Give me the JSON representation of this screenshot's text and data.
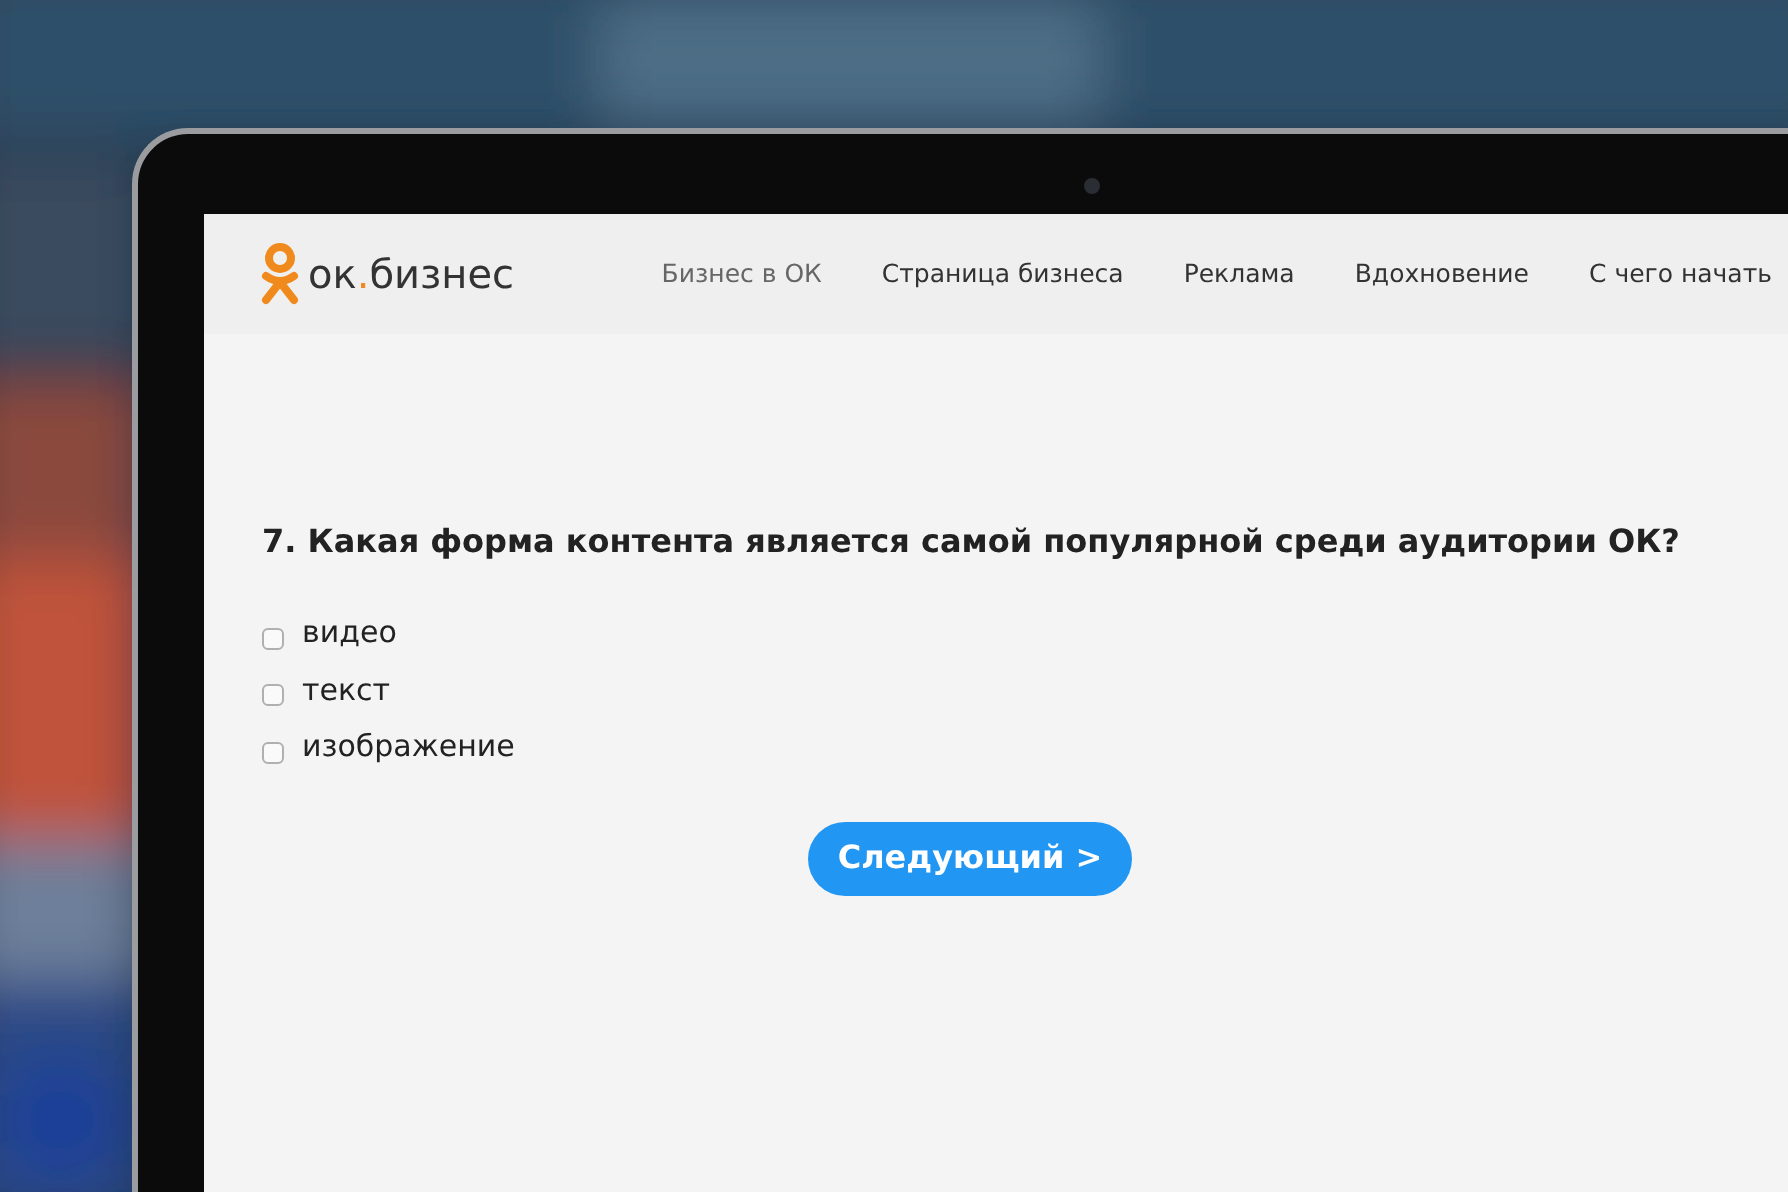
{
  "header": {
    "logo_parts": [
      "ок",
      ".",
      "бизнес"
    ],
    "nav": [
      {
        "label": "Бизнес в ОК",
        "selected": true
      },
      {
        "label": "Страница бизнеса",
        "selected": false
      },
      {
        "label": "Реклама",
        "selected": false
      },
      {
        "label": "Вдохновение",
        "selected": false
      },
      {
        "label": "С чего начать",
        "selected": false
      }
    ]
  },
  "question": {
    "title": "7. Какая форма контента является самой популярной среди аудитории ОК?",
    "options": [
      {
        "label": "видео",
        "checked": false
      },
      {
        "label": "текст",
        "checked": false
      },
      {
        "label": "изображение",
        "checked": false
      }
    ]
  },
  "next_button": "Следующий >"
}
